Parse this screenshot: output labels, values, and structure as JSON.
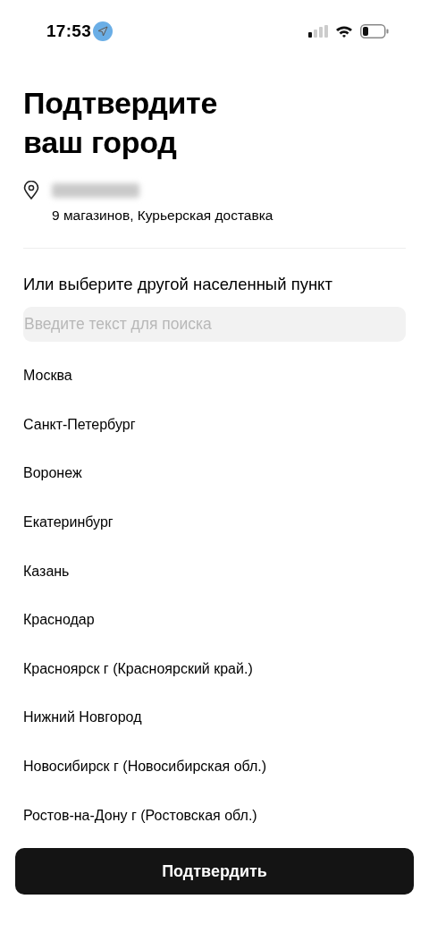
{
  "status_bar": {
    "time": "17:53"
  },
  "title": "Подтвердите ваш город",
  "current_city": {
    "details": "9 магазинов, Курьерская доставка"
  },
  "other_heading": "Или выберите другой населенный пункт",
  "search": {
    "placeholder": "Введите текст для поиска"
  },
  "cities": [
    "Москва",
    "Санкт-Петербург",
    "Воронеж",
    "Екатеринбург",
    "Казань",
    "Краснодар",
    "Красноярск г (Красноярский край.)",
    "Нижний Новгород",
    "Новосибирск г (Новосибирская обл.)",
    "Ростов-на-Дону г (Ростовская обл.)"
  ],
  "confirm_button": "Подтвердить"
}
